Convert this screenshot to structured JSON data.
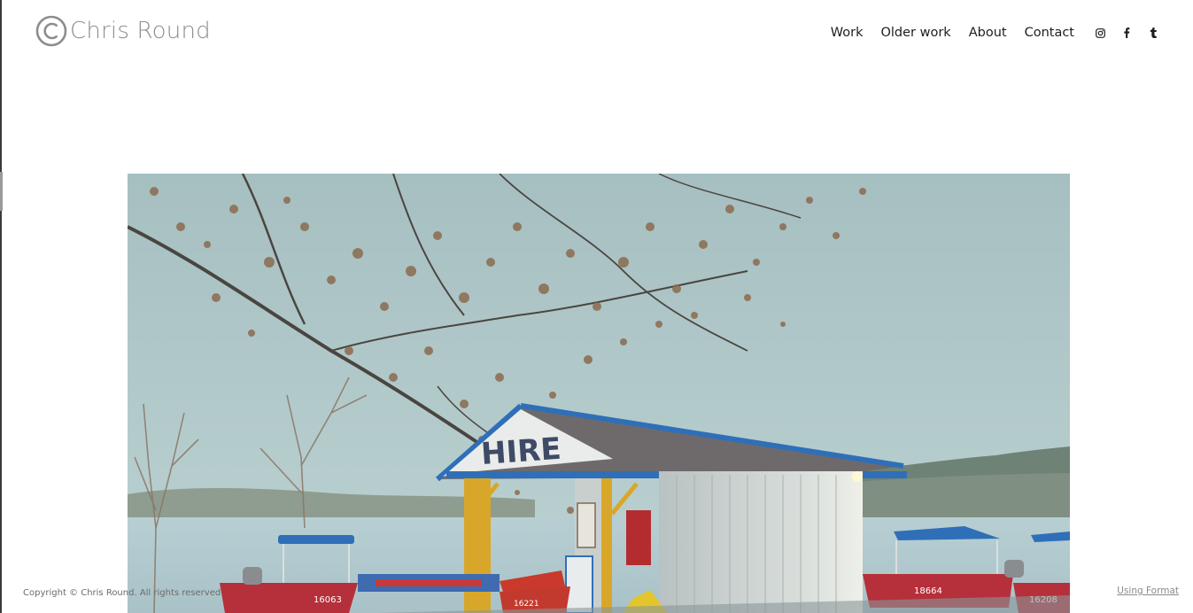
{
  "header": {
    "logo_text": "Chris Round",
    "nav": [
      {
        "label": "Work"
      },
      {
        "label": "Older work"
      },
      {
        "label": "About"
      },
      {
        "label": "Contact"
      }
    ],
    "social": [
      {
        "icon": "instagram-icon"
      },
      {
        "icon": "facebook-icon"
      },
      {
        "icon": "tumblr-icon"
      }
    ]
  },
  "hero": {
    "sign_text": "HIRE",
    "boat_numbers": [
      "16063",
      "16221",
      "18664",
      "16208"
    ]
  },
  "footer": {
    "copyright": "Copyright © Chris Round. All rights reserved.",
    "using_format": "Using Format"
  },
  "colors": {
    "sky": "#a9c3c5",
    "water": "#b5cdd0",
    "roof_trim": "#2f6fb8",
    "boat_red": "#b5303a",
    "nav_text": "#1e1e1e",
    "logo_text": "#8d8d8d"
  }
}
